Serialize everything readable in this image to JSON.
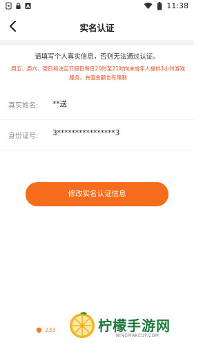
{
  "status_bar": {
    "time": "11:38",
    "icons": [
      "notification-icon",
      "lock-icon",
      "a-icon",
      "wifi-icon",
      "battery-icon"
    ]
  },
  "nav": {
    "title": "实名认证",
    "back_icon": "chevron-left-icon"
  },
  "notice": "请填写个人真实信息，否则无法通过认证。",
  "warning": "周五、周六、周日和法定节假日每日20时至21时向未成年人提供1小时游戏服务，充值金额也有限制",
  "fields": [
    {
      "label": "真实姓名:",
      "value": "**送"
    },
    {
      "label": "身份证号:",
      "value": "3****************3"
    }
  ],
  "action_button": "修改实名认证信息",
  "footer": {
    "likes": "233",
    "watermark_title": "柠檬手游网",
    "watermark_url": "NINGMAKEUP.COM"
  },
  "colors": {
    "accent": "#f66c1d",
    "warning": "#e8471d",
    "watermark": "#1c7a3a"
  }
}
